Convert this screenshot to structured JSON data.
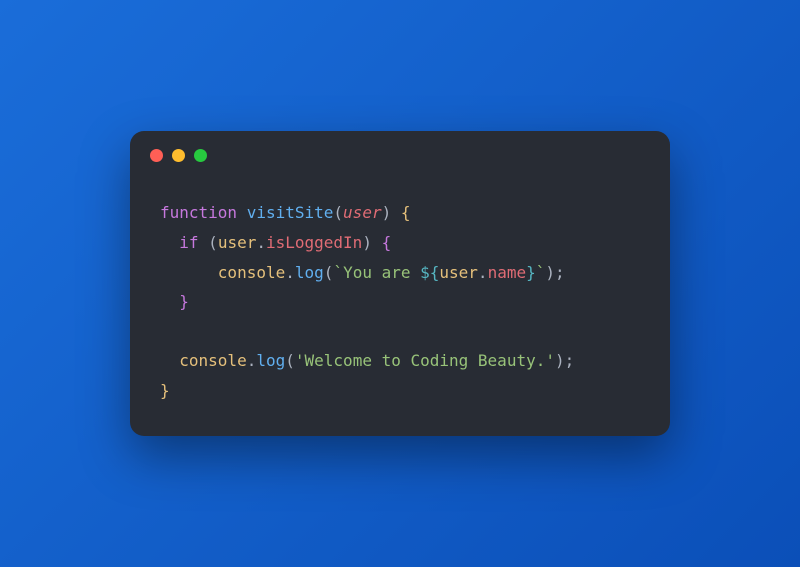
{
  "code": {
    "line1": {
      "kw": "function",
      "sp1": " ",
      "fn": "visitSite",
      "open": "(",
      "param": "user",
      "close": ") ",
      "brace": "{"
    },
    "line2": {
      "indent": "  ",
      "kw": "if",
      "sp": " ",
      "open": "(",
      "obj": "user",
      "dot": ".",
      "prop": "isLoggedIn",
      "close": ") ",
      "brace": "{"
    },
    "line3": {
      "indent": "      ",
      "obj": "console",
      "dot": ".",
      "fn": "log",
      "open": "(",
      "tick1": "`",
      "str1": "You are ",
      "tmplOpen": "${",
      "tobj": "user",
      "tdot": ".",
      "tprop": "name",
      "tmplClose": "}",
      "tick2": "`",
      "close": ");"
    },
    "line4": {
      "indent": "  ",
      "brace": "}"
    },
    "line5": "",
    "line6": {
      "indent": "  ",
      "obj": "console",
      "dot": ".",
      "fn": "log",
      "open": "(",
      "str": "'Welcome to Coding Beauty.'",
      "close": ");"
    },
    "line7": {
      "brace": "}"
    }
  }
}
